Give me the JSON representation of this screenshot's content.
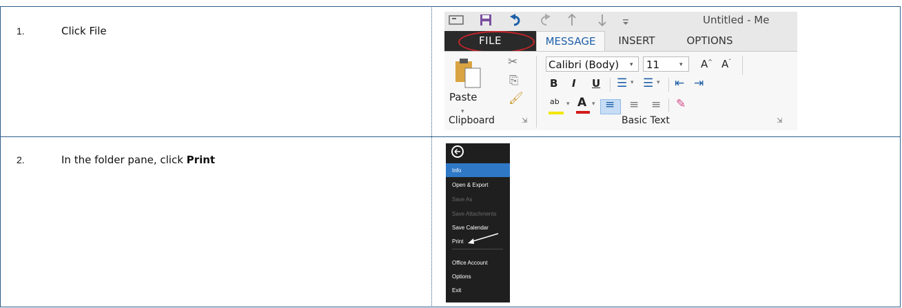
{
  "steps": [
    {
      "number": "1.",
      "text": "Click File"
    },
    {
      "number": "2.",
      "text_before": "In the folder pane, click ",
      "text_bold": "Print"
    }
  ],
  "ribbon": {
    "window_title": "Untitled - Me",
    "qat_icons": [
      "email-icon",
      "save-icon",
      "undo-icon",
      "redo-icon",
      "up-arrow-icon",
      "down-arrow-icon",
      "customize-icon"
    ],
    "tabs": {
      "file": "FILE",
      "message": "MESSAGE",
      "insert": "INSERT",
      "options": "OPTIONS"
    },
    "paste_label": "Paste",
    "font_name": "Calibri (Body)",
    "font_size": "11",
    "bold": "B",
    "italic": "I",
    "underline": "U",
    "highlight_letters": "ab",
    "font_color_letter": "A",
    "grow_font": "A",
    "shrink_font": "A",
    "group_clipboard": "Clipboard",
    "group_basic_text": "Basic Text",
    "colors": {
      "file_tab": "#2a2a2a",
      "accent": "#1e5fa8",
      "highlight_ring": "#c8252b"
    }
  },
  "backstage": {
    "items": [
      {
        "label": "Info",
        "state": "selected"
      },
      {
        "label": "Open & Export",
        "state": "normal"
      },
      {
        "label": "Save As",
        "state": "disabled"
      },
      {
        "label": "Save Attachments",
        "state": "disabled"
      },
      {
        "label": "Save Calendar",
        "state": "normal"
      },
      {
        "label": "Print",
        "state": "normal"
      },
      {
        "label": "Office Account",
        "state": "normal"
      },
      {
        "label": "Options",
        "state": "normal"
      },
      {
        "label": "Exit",
        "state": "normal"
      }
    ],
    "colors": {
      "background": "#1f1f1f",
      "selected": "#2e78c6"
    }
  }
}
